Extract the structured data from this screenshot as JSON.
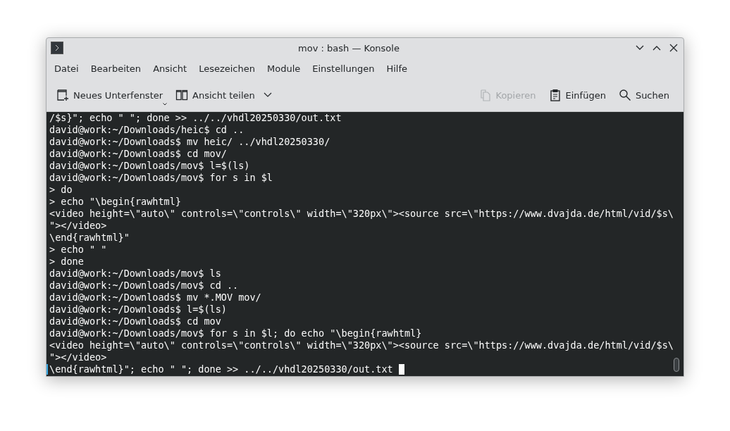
{
  "window": {
    "title": "mov : bash — Konsole"
  },
  "menu": [
    "Datei",
    "Bearbeiten",
    "Ansicht",
    "Lesezeichen",
    "Module",
    "Einstellungen",
    "Hilfe"
  ],
  "toolbar": {
    "left": [
      {
        "kind": "new-tab",
        "label": "Neues Unterfenster",
        "disabled": false
      },
      {
        "kind": "split",
        "label": "Ansicht teilen",
        "disabled": false
      }
    ],
    "right": [
      {
        "kind": "copy",
        "label": "Kopieren",
        "disabled": true
      },
      {
        "kind": "paste",
        "label": "Einfügen",
        "disabled": false
      },
      {
        "kind": "search",
        "label": "Suchen",
        "disabled": false
      }
    ]
  },
  "terminal": {
    "cursor_visible": true,
    "lines": [
      "/$s}\"; echo \" \"; done >> ../../vhdl20250330/out.txt",
      "david@work:~/Downloads/heic$ cd ..",
      "david@work:~/Downloads$ mv heic/ ../vhdl20250330/",
      "david@work:~/Downloads$ cd mov/",
      "david@work:~/Downloads/mov$ l=$(ls)",
      "david@work:~/Downloads/mov$ for s in $l",
      "> do",
      "> echo \"\\begin{rawhtml}",
      "<video height=\\\"auto\\\" controls=\\\"controls\\\" width=\\\"320px\\\"><source src=\\\"https://www.dvajda.de/html/vid/$s\\",
      "\"></video>",
      "\\end{rawhtml}\"",
      "> echo \" \"",
      "> done",
      "david@work:~/Downloads/mov$ ls",
      "david@work:~/Downloads/mov$ cd ..",
      "david@work:~/Downloads$ mv *.MOV mov/",
      "david@work:~/Downloads$ l=$(ls)",
      "david@work:~/Downloads$ cd mov",
      "david@work:~/Downloads/mov$ for s in $l; do echo \"\\begin{rawhtml}",
      "<video height=\\\"auto\\\" controls=\\\"controls\\\" width=\\\"320px\\\"><source src=\\\"https://www.dvajda.de/html/vid/$s\\",
      "\"></video>",
      "\\end{rawhtml}\"; echo \" \"; done >> ../../vhdl20250330/out.txt"
    ]
  }
}
